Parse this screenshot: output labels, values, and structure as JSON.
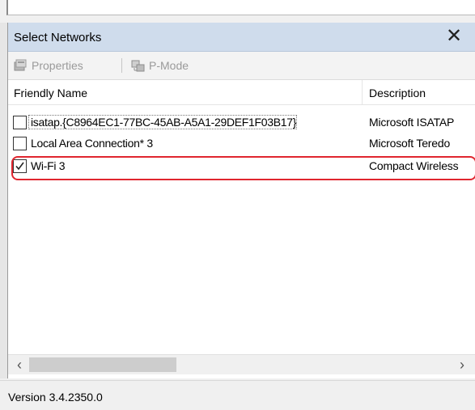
{
  "window": {
    "title": "Select Networks",
    "close_glyph": "✕"
  },
  "toolbar": {
    "properties_label": "Properties",
    "pmode_label": "P-Mode"
  },
  "table": {
    "columns": [
      "Friendly Name",
      "Description"
    ],
    "rows": [
      {
        "checked": false,
        "name": "isatap.{C8964EC1-77BC-45AB-A5A1-29DEF1F03B17}",
        "description": "Microsoft ISATAP"
      },
      {
        "checked": false,
        "name": "Local Area Connection* 3",
        "description": "Microsoft Teredo"
      },
      {
        "checked": true,
        "name": "Wi-Fi 3",
        "description": "Compact Wireless"
      }
    ]
  },
  "scrollbar": {
    "left_arrow": "‹",
    "right_arrow": "›"
  },
  "status": {
    "version": "Version 3.4.2350.0"
  },
  "colors": {
    "title_bar": "#cfdcec",
    "highlight": "#e0262f",
    "disabled_text": "#9a9a9a"
  }
}
